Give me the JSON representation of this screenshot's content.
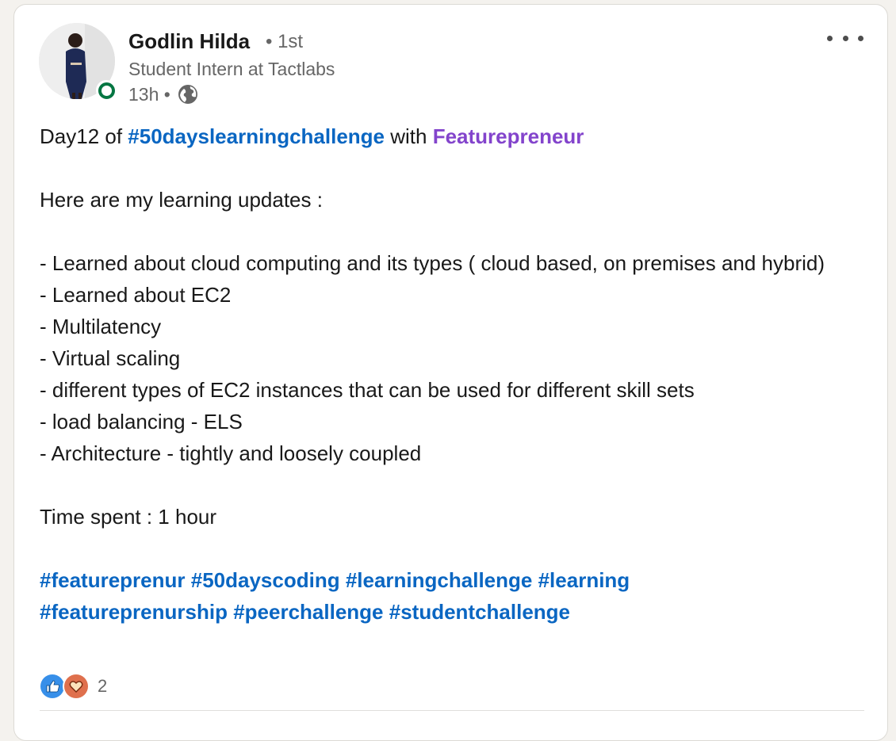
{
  "author": {
    "name": "Godlin Hilda",
    "degree": "• 1st",
    "headline": "Student Intern at Tactlabs",
    "time": "13h •"
  },
  "post": {
    "line1": {
      "prefix": "Day12 of ",
      "hashtag": "#50dayslearningchallenge",
      "middle": " with ",
      "mention": "Featurepreneur"
    },
    "intro": "Here are my learning updates :",
    "items": [
      "- Learned about cloud computing and its types ( cloud based, on premises and hybrid)",
      "- Learned about EC2",
      "- Multilatency",
      "- Virtual scaling",
      "- different types of EC2 instances that can be used for different skill sets",
      "- load balancing - ELS",
      "- Architecture - tightly and loosely coupled"
    ],
    "time_spent": "Time spent : 1 hour",
    "hashtags_row1": [
      "#featureprenur",
      "#50dayscoding",
      "#learningchallenge",
      "#learning"
    ],
    "hashtags_row2": [
      "#featureprenurship",
      "#peerchallenge",
      "#studentchallenge"
    ]
  },
  "reactions": {
    "count": "2",
    "icons": [
      "like-icon",
      "love-icon"
    ]
  },
  "colors": {
    "hashtag": "#0a66c2",
    "mention": "#8344cc",
    "online": "#057642",
    "like": "#378fe9",
    "love": "#df704d"
  }
}
